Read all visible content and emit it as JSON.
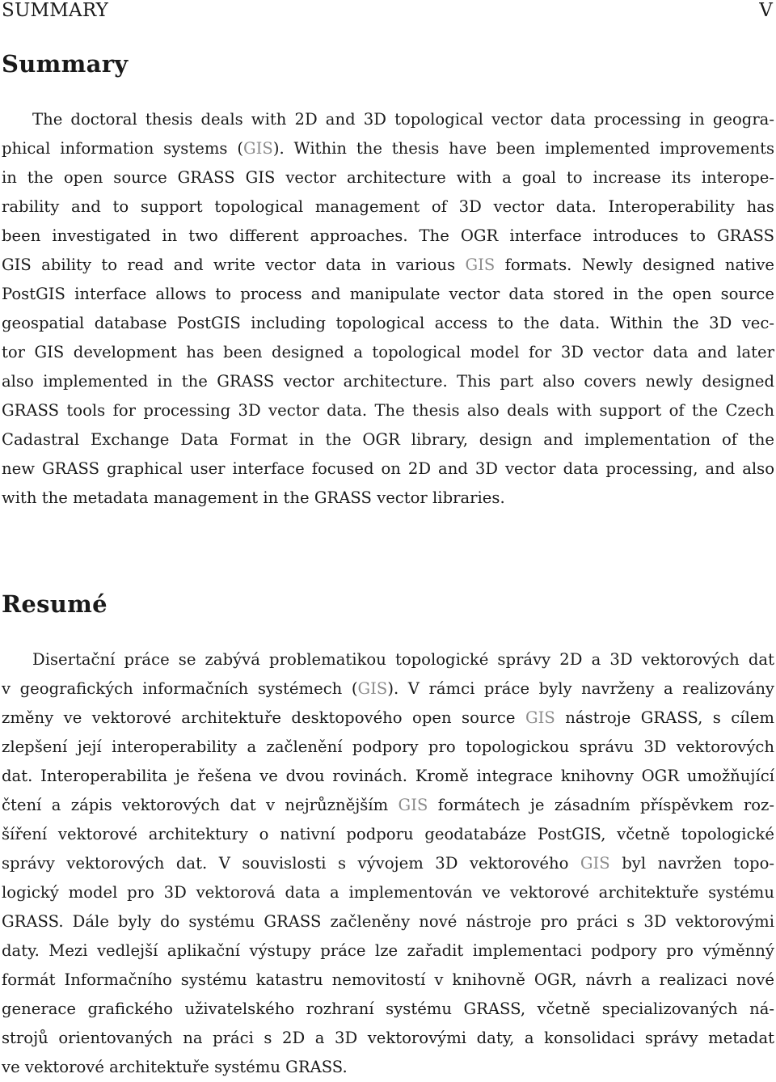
{
  "running_head": {
    "left": "SUMMARY",
    "right": "V"
  },
  "summary": {
    "heading": "Summary",
    "lines": [
      [
        "The doctoral thesis deals with 2D and 3D topological vector data processing in geogra-"
      ],
      [
        "phical information systems (",
        {
          "acr": "GIS"
        },
        "). Within the thesis have been implemented improvements"
      ],
      [
        "in the open source GRASS GIS vector architecture with a goal to increase its interope-"
      ],
      [
        "rability and to support topological management of 3D vector data. Interoperability has"
      ],
      [
        "been investigated in two different approaches. The OGR interface introduces to GRASS"
      ],
      [
        "GIS ability to read and write vector data in various ",
        {
          "acr": "GIS"
        },
        " formats. Newly designed native"
      ],
      [
        "PostGIS interface allows to process and manipulate vector data stored in the open source"
      ],
      [
        "geospatial database PostGIS including topological access to the data. Within the 3D vec-"
      ],
      [
        "tor GIS development has been designed a topological model for 3D vector data and later"
      ],
      [
        "also implemented in the GRASS vector architecture. This part also covers newly designed"
      ],
      [
        "GRASS tools for processing 3D vector data. The thesis also deals with support of the Czech"
      ],
      [
        "Cadastral Exchange Data Format in the OGR library, design and implementation of the"
      ],
      [
        "new GRASS graphical user interface focused on 2D and 3D vector data processing, and also"
      ],
      [
        "with the metadata management in the GRASS vector libraries."
      ]
    ]
  },
  "resume": {
    "heading": "Resumé",
    "lines": [
      [
        "Disertační práce se zabývá problematikou topologické správy 2D a 3D vektorových dat"
      ],
      [
        "v geografických informačních systémech (",
        {
          "acr": "GIS"
        },
        "). V rámci práce byly navrženy a realizovány"
      ],
      [
        "změny ve vektorové architektuře desktopového open source ",
        {
          "acr": "GIS"
        },
        " nástroje GRASS, s cílem"
      ],
      [
        "zlepšení její interoperability a začlenění podpory pro topologickou správu 3D vektorových"
      ],
      [
        "dat. Interoperabilita je řešena ve dvou rovinách. Kromě integrace knihovny OGR umožňující"
      ],
      [
        "čtení a zápis vektorových dat v nejrůznějším ",
        {
          "acr": "GIS"
        },
        " formátech je zásadním příspěvkem roz-"
      ],
      [
        "šíření vektorové architektury o nativní podporu geodatabáze PostGIS, včetně topologické"
      ],
      [
        "správy vektorových dat. V souvislosti s vývojem 3D vektorového ",
        {
          "acr": "GIS"
        },
        " byl navržen topo-"
      ],
      [
        "logický model pro 3D vektorová data a implementován ve vektorové architektuře systému"
      ],
      [
        "GRASS. Dále byly do systému GRASS začleněny nové nástroje pro práci s 3D vektorovými"
      ],
      [
        "daty. Mezi vedlejší aplikační výstupy práce lze zařadit implementaci podpory pro výměnný"
      ],
      [
        "formát Informačního systému katastru nemovitostí v knihovně OGR, návrh a realizaci nové"
      ],
      [
        "generace grafického uživatelského rozhraní systému GRASS, včetně specializovaných ná-"
      ],
      [
        "strojů orientovaných na práci s 2D a 3D vektorovými daty, a konsolidaci správy metadat"
      ],
      [
        "ve vektorové architektuře systému GRASS."
      ]
    ]
  }
}
